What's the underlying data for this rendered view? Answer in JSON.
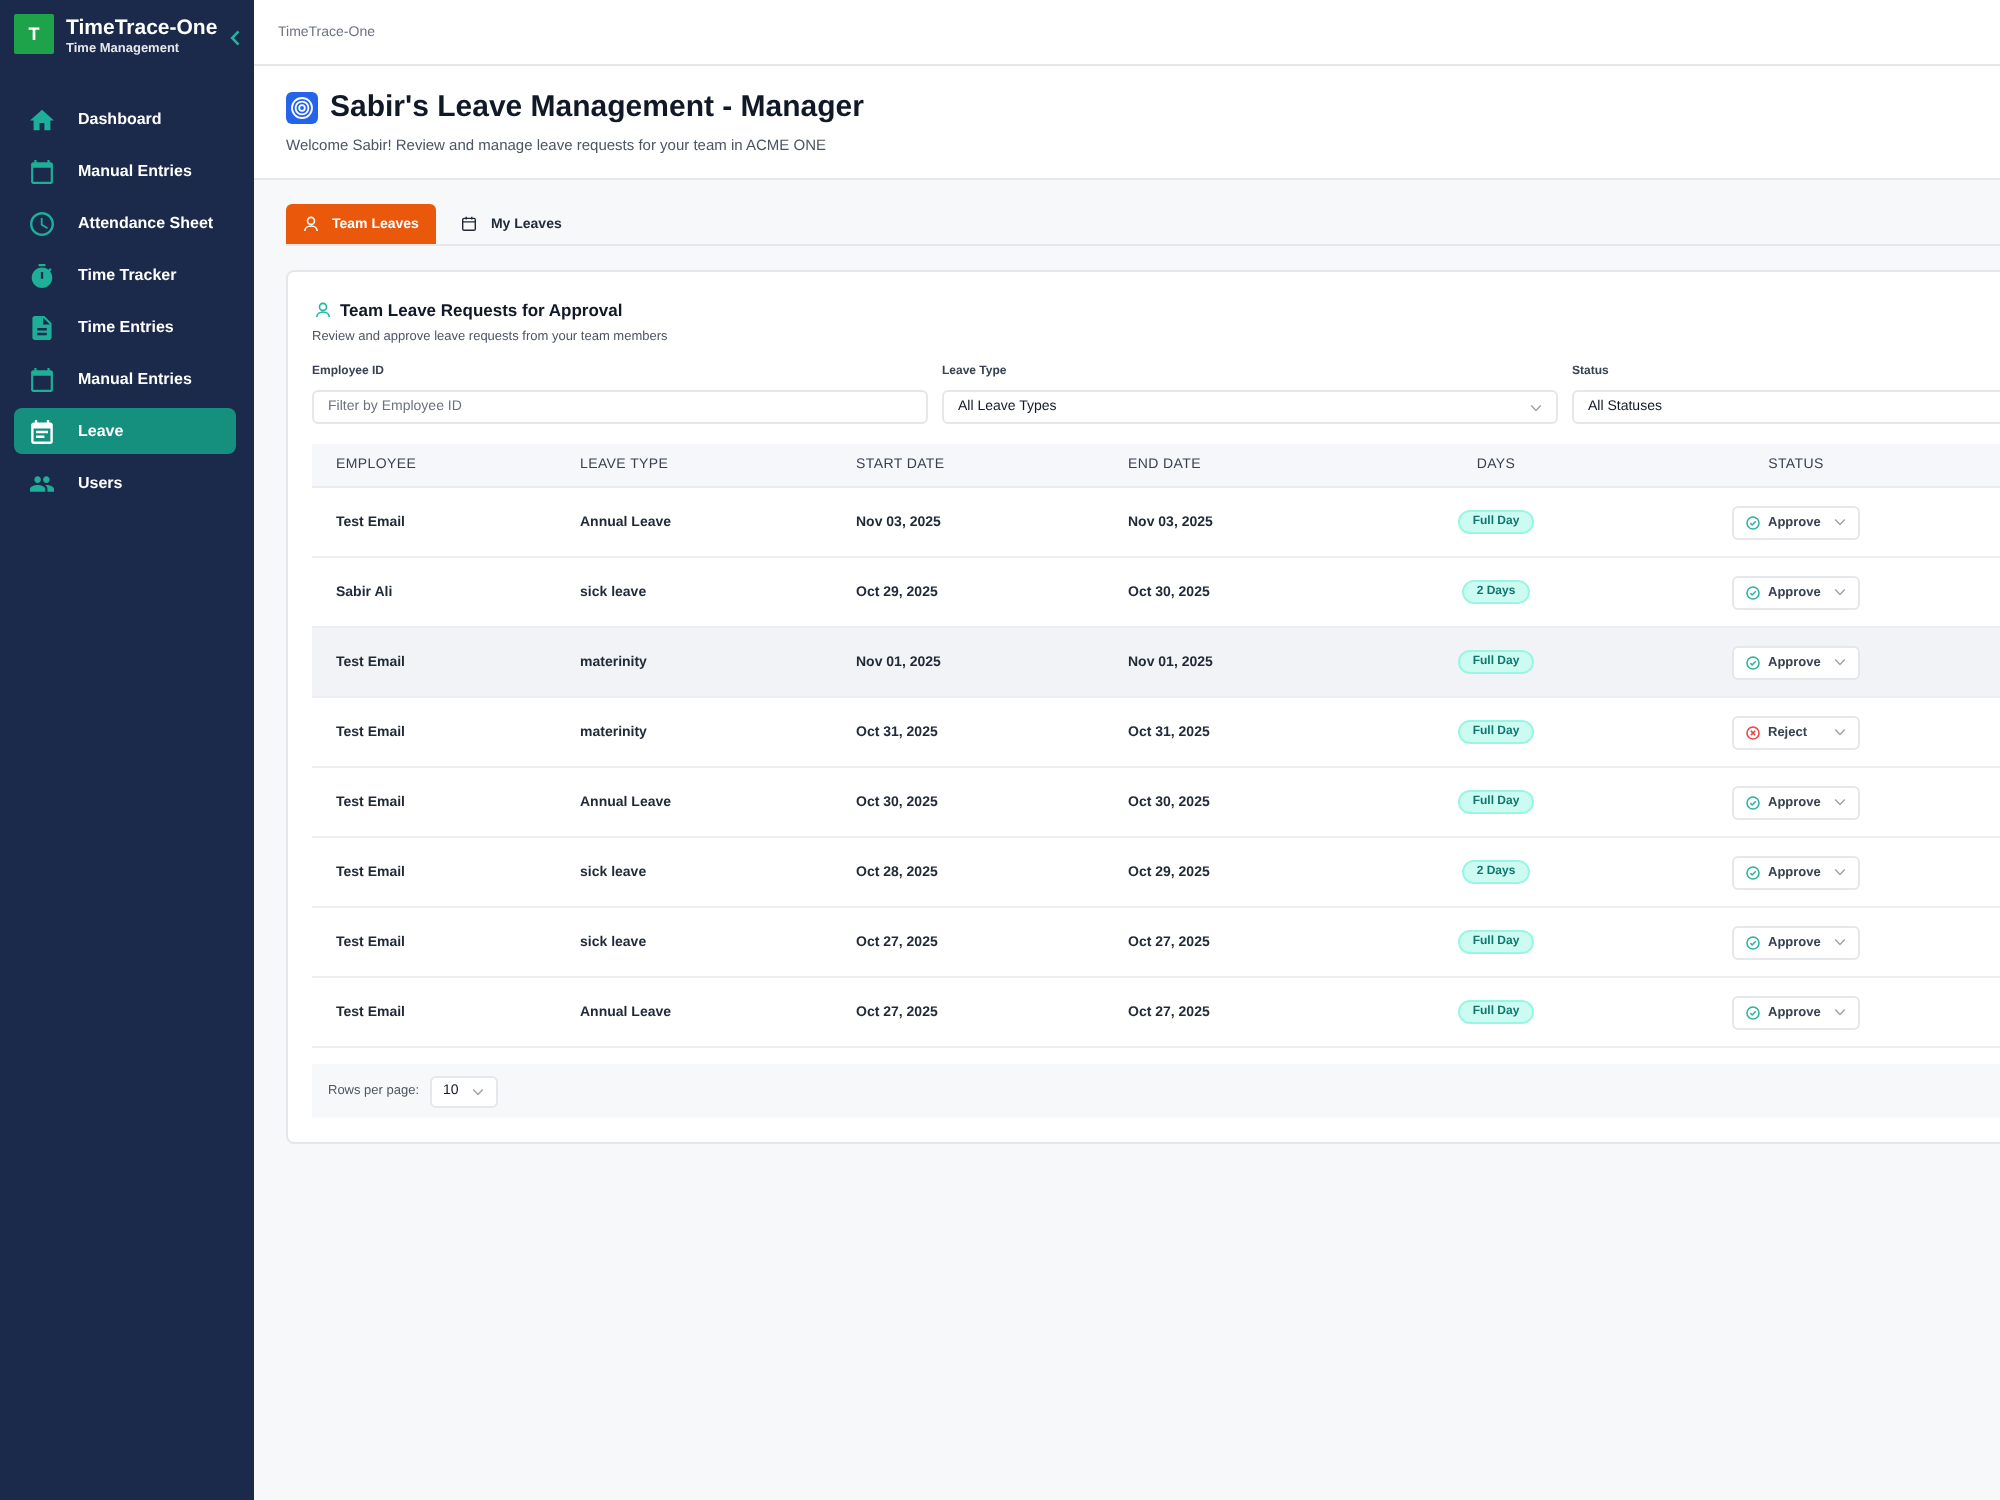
{
  "sidebar": {
    "logo_letter": "T",
    "app_name": "TimeTrace-One",
    "app_subtitle": "Time Management",
    "items": [
      {
        "label": "Dashboard",
        "selected": false
      },
      {
        "label": "Manual Entries",
        "selected": false
      },
      {
        "label": "Attendance Sheet",
        "selected": false
      },
      {
        "label": "Time Tracker",
        "selected": false
      },
      {
        "label": "Time Entries",
        "selected": false
      },
      {
        "label": "Manual Entries",
        "selected": false
      },
      {
        "label": "Leave",
        "selected": true
      },
      {
        "label": "Users",
        "selected": false
      }
    ]
  },
  "breadcrumb": "TimeTrace-One",
  "header": {
    "title": "Sabir's Leave Management - Manager",
    "subtitle": "Welcome Sabir! Review and manage leave requests for your team in ACME ONE"
  },
  "tabs": [
    {
      "label": "Team Leaves",
      "selected": true
    },
    {
      "label": "My Leaves",
      "selected": false
    }
  ],
  "card": {
    "title": "Team Leave Requests for Approval",
    "subtitle": "Review and approve leave requests from your team members",
    "filters": [
      {
        "label": "Employee ID",
        "kind": "input",
        "placeholder": "Filter by Employee ID"
      },
      {
        "label": "Leave Type",
        "kind": "select",
        "value": "All Leave Types"
      },
      {
        "label": "Status",
        "kind": "select",
        "value": "All Statuses"
      }
    ],
    "table": {
      "columns": [
        "EMPLOYEE",
        "LEAVE TYPE",
        "START DATE",
        "END DATE",
        "DAYS",
        "STATUS"
      ],
      "rows": [
        {
          "employee": "Test Email",
          "leave_type": "Annual Leave",
          "start_date": "Nov 03, 2025",
          "end_date": "Nov 03, 2025",
          "days": "Full Day",
          "status": {
            "label": "Approve",
            "kind": "approve"
          },
          "highlighted": false
        },
        {
          "employee": "Sabir Ali",
          "leave_type": "sick leave",
          "start_date": "Oct 29, 2025",
          "end_date": "Oct 30, 2025",
          "days": "2 Days",
          "status": {
            "label": "Approve",
            "kind": "approve"
          },
          "highlighted": false
        },
        {
          "employee": "Test Email",
          "leave_type": "materinity",
          "start_date": "Nov 01, 2025",
          "end_date": "Nov 01, 2025",
          "days": "Full Day",
          "status": {
            "label": "Approve",
            "kind": "approve"
          },
          "highlighted": true
        },
        {
          "employee": "Test Email",
          "leave_type": "materinity",
          "start_date": "Oct 31, 2025",
          "end_date": "Oct 31, 2025",
          "days": "Full Day",
          "status": {
            "label": "Reject",
            "kind": "reject"
          },
          "highlighted": false
        },
        {
          "employee": "Test Email",
          "leave_type": "Annual Leave",
          "start_date": "Oct 30, 2025",
          "end_date": "Oct 30, 2025",
          "days": "Full Day",
          "status": {
            "label": "Approve",
            "kind": "approve"
          },
          "highlighted": false
        },
        {
          "employee": "Test Email",
          "leave_type": "sick leave",
          "start_date": "Oct 28, 2025",
          "end_date": "Oct 29, 2025",
          "days": "2 Days",
          "status": {
            "label": "Approve",
            "kind": "approve"
          },
          "highlighted": false
        },
        {
          "employee": "Test Email",
          "leave_type": "sick leave",
          "start_date": "Oct 27, 2025",
          "end_date": "Oct 27, 2025",
          "days": "Full Day",
          "status": {
            "label": "Approve",
            "kind": "approve"
          },
          "highlighted": false
        },
        {
          "employee": "Test Email",
          "leave_type": "Annual Leave",
          "start_date": "Oct 27, 2025",
          "end_date": "Oct 27, 2025",
          "days": "Full Day",
          "status": {
            "label": "Approve",
            "kind": "approve"
          },
          "highlighted": false
        }
      ]
    },
    "pagination": {
      "label": "Rows per page:",
      "value": "10"
    }
  }
}
